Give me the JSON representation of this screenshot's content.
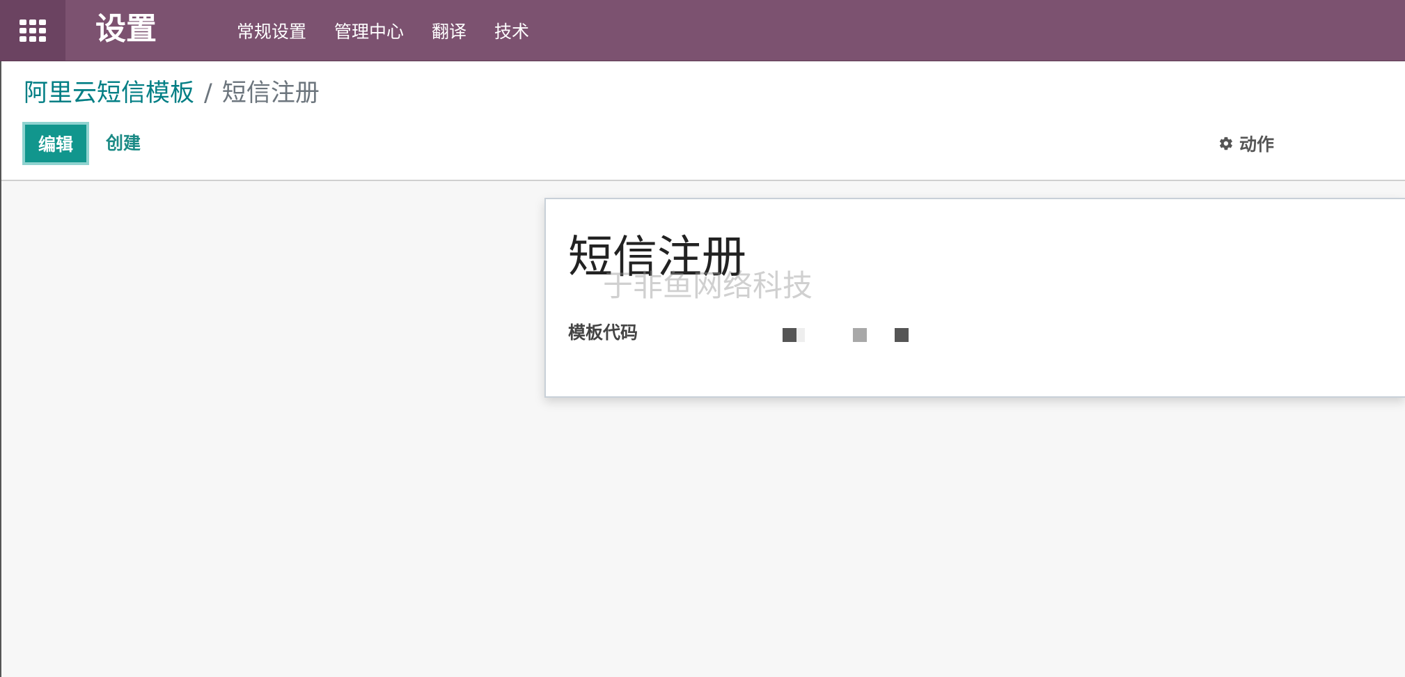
{
  "app": {
    "title": "设置"
  },
  "topnav": {
    "items": [
      "常规设置",
      "管理中心",
      "翻译",
      "技术"
    ]
  },
  "breadcrumb": {
    "parent": "阿里云短信模板",
    "separator": "/",
    "current": "短信注册"
  },
  "toolbar": {
    "edit_label": "编辑",
    "create_label": "创建",
    "action_label": "动作"
  },
  "record": {
    "title": "短信注册",
    "watermark": "于非鱼网络科技",
    "field_label": "模板代码"
  },
  "colors": {
    "topbar": "#7c5270",
    "primary": "#11968d",
    "link": "#017e84"
  }
}
